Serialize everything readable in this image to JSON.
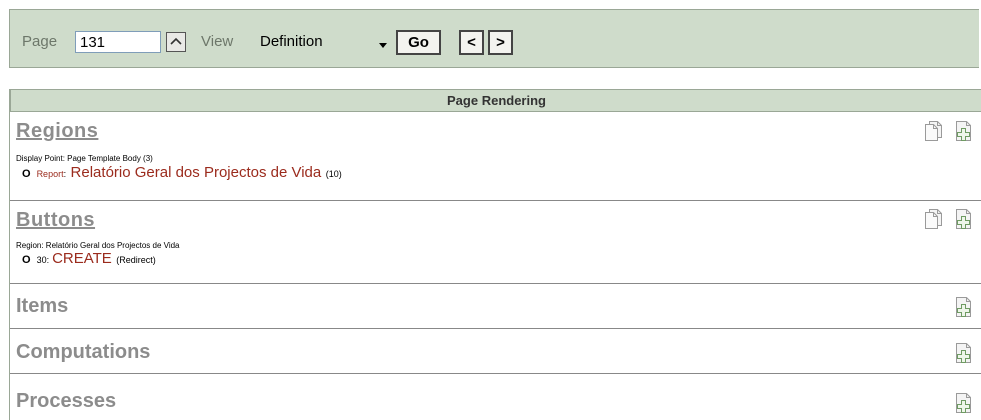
{
  "toolbar": {
    "page_label": "Page",
    "page_value": "131",
    "view_label": "View",
    "view_selected": "Definition",
    "go_label": "Go",
    "prev_label": "<",
    "next_label": ">"
  },
  "rendering": {
    "header": "Page Rendering",
    "regions": {
      "title": "Regions",
      "display_point": "Display Point: Page Template Body (3)",
      "entry_type": "Report",
      "entry_colon": ":",
      "entry_name": "Relatório Geral dos Projectos de Vida",
      "entry_count": "(10)"
    },
    "buttons": {
      "title": "Buttons",
      "region": "Region: Relatório Geral dos Projectos de Vida",
      "entry_seq": "30:",
      "entry_name": "CREATE",
      "entry_action": "(Redirect)"
    },
    "items": {
      "title": "Items"
    },
    "computations": {
      "title": "Computations"
    },
    "processes": {
      "title": "Processes"
    }
  },
  "icons": {
    "copy": "copy-icon",
    "create": "create-icon",
    "page_up": "caret-up-icon",
    "dropdown": "dropdown-arrow-icon"
  },
  "colors": {
    "toolbar_bg": "#cfdccb",
    "link_red": "#9b2b1d",
    "section_gray": "#8c8c8c"
  }
}
